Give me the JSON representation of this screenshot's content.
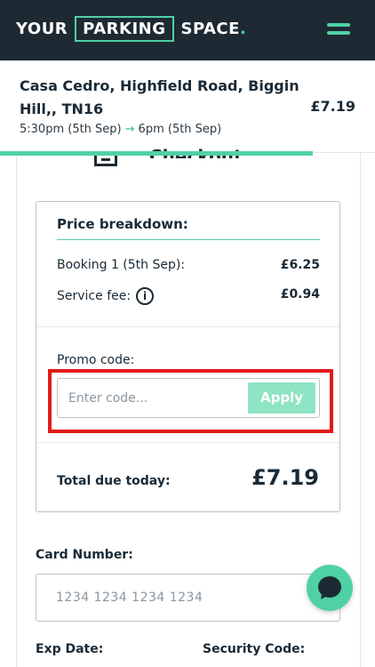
{
  "header": {
    "logo": {
      "word1": "YOUR",
      "word2": "PARKING",
      "word3": "SPACE",
      "dot": "."
    },
    "menu_icon": "hamburger-menu-icon"
  },
  "booking": {
    "location": "Casa Cedro, Highfield Road, Biggin Hill,, TN16",
    "price": "£7.19",
    "start": "5:30pm (5th Sep)",
    "arrow": "→",
    "end": "6pm (5th Sep)"
  },
  "checkout": {
    "title_peek": "Checkout"
  },
  "price_breakdown": {
    "title": "Price breakdown:",
    "lines": [
      {
        "label": "Booking 1 (5th Sep):",
        "amount": "£6.25"
      },
      {
        "label": "Service fee:",
        "amount": "£0.94"
      }
    ],
    "info_icon_glyph": "i",
    "promo_label": "Promo code:",
    "promo_placeholder": "Enter code...",
    "apply_label": "Apply",
    "total_label": "Total due today:",
    "total_amount": "£7.19"
  },
  "payment": {
    "card_number_label": "Card Number:",
    "card_placeholder": "1234 1234 1234 1234",
    "exp_label": "Exp Date:",
    "security_label": "Security Code:"
  },
  "colors": {
    "accent": "#4fd1a5",
    "header_bg": "#1e2a33",
    "highlight": "#e31919"
  }
}
